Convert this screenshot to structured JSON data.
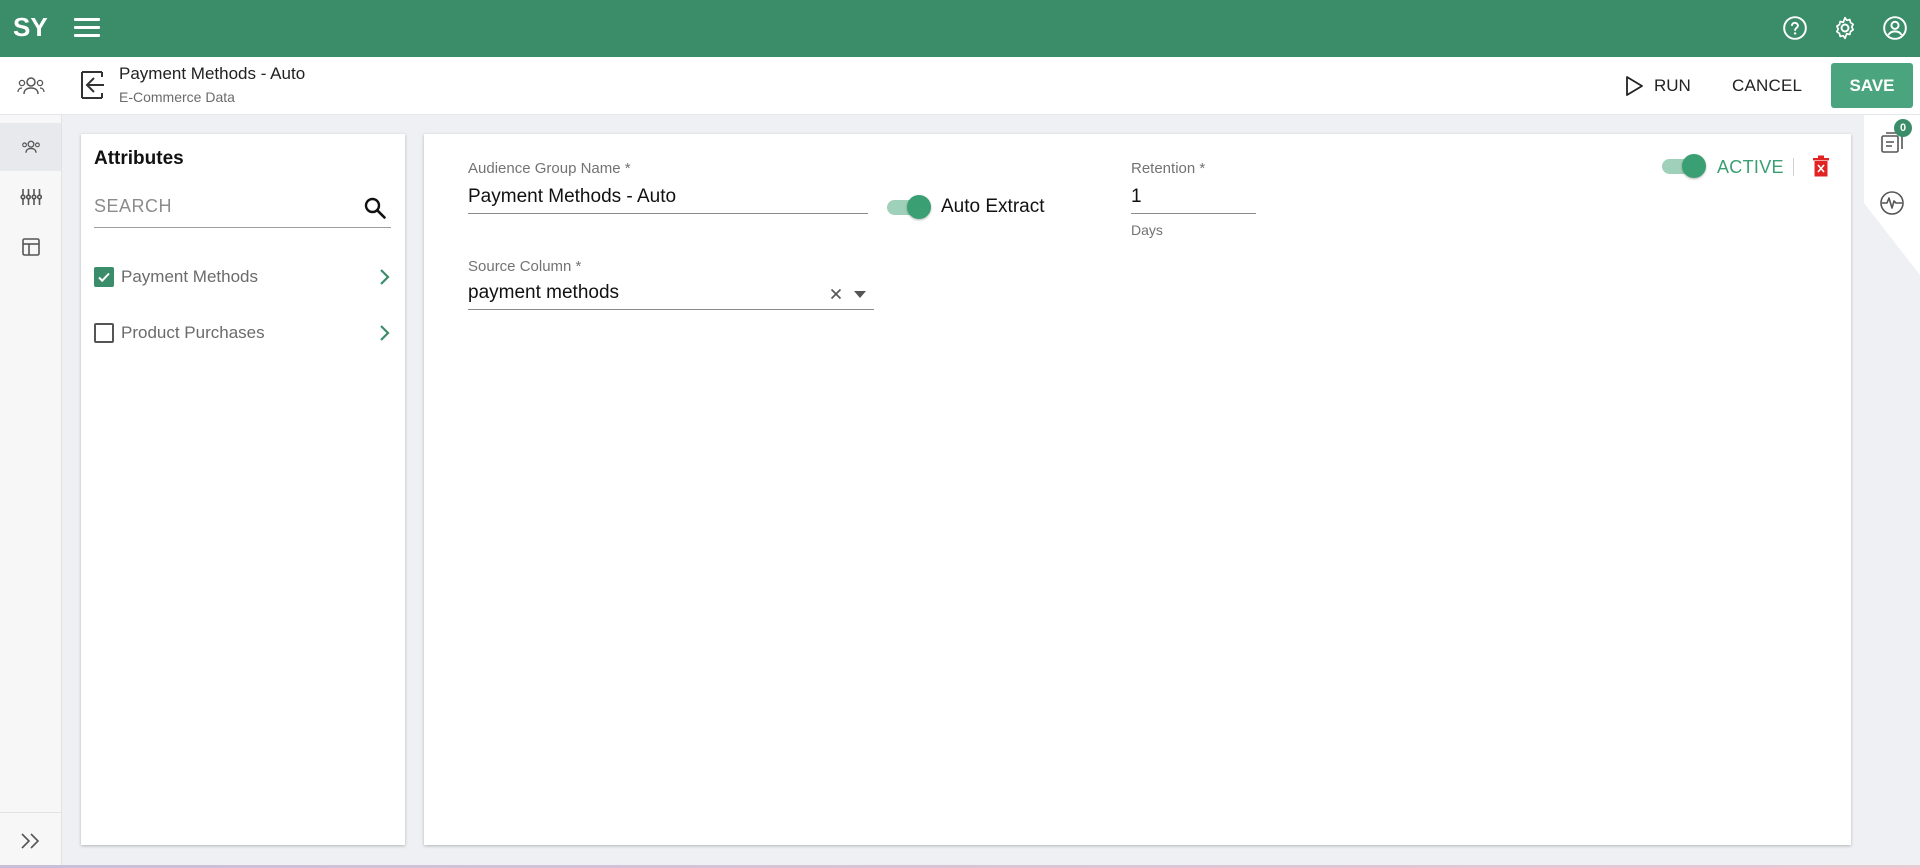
{
  "app": {
    "logo_text": "SY"
  },
  "header": {
    "title": "Payment Methods - Auto",
    "subtitle": "E-Commerce Data",
    "run_label": "RUN",
    "cancel_label": "CANCEL",
    "save_label": "SAVE"
  },
  "top_icons": [
    "help-icon",
    "gear-icon",
    "account-icon"
  ],
  "left_nav": {
    "items": [
      "audience-icon",
      "sliders-icon",
      "layout-icon"
    ],
    "expand_icon": "double-chevron-right-icon"
  },
  "attributes": {
    "title": "Attributes",
    "search_placeholder": "SEARCH",
    "items": [
      {
        "label": "Payment Methods",
        "checked": true
      },
      {
        "label": "Product Purchases",
        "checked": false
      }
    ]
  },
  "form": {
    "audience_group_name_label": "Audience Group Name *",
    "audience_group_name_value": "Payment Methods - Auto",
    "auto_extract_label": "Auto Extract",
    "auto_extract_on": true,
    "retention_label": "Retention *",
    "retention_value": "1",
    "retention_unit": "Days",
    "source_column_label": "Source Column *",
    "source_column_value": "payment methods",
    "active_label": "ACTIVE",
    "active_on": true
  },
  "right_rail": {
    "notes_badge": "0"
  },
  "colors": {
    "brand_green": "#3b8d6a",
    "save_green": "#4aa57e",
    "toggle_green": "#3a9f72",
    "delete_red": "#e02424"
  }
}
